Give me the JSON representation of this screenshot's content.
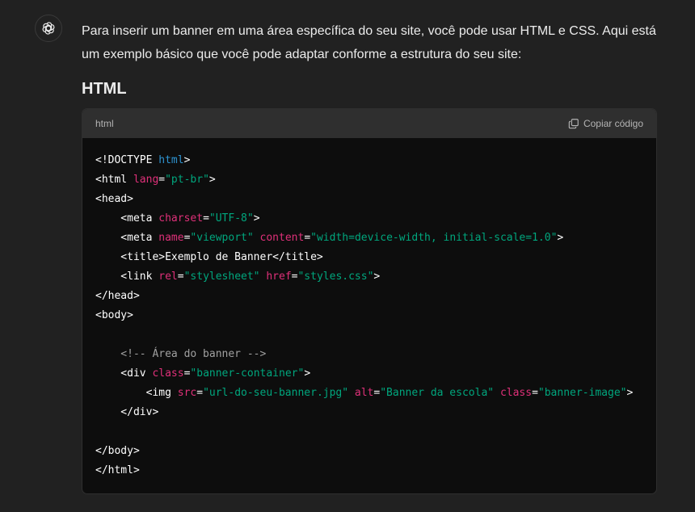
{
  "message": {
    "intro": "Para inserir um banner em uma área específica do seu site, você pode usar HTML e CSS. Aqui está um exemplo básico que você pode adaptar conforme a estrutura do seu site:",
    "heading": "HTML"
  },
  "code_block": {
    "language": "html",
    "copy_label": "Copiar código",
    "lines": [
      [
        {
          "t": "tag",
          "v": "<!DOCTYPE "
        },
        {
          "t": "kw",
          "v": "html"
        },
        {
          "t": "tag",
          "v": ">"
        }
      ],
      [
        {
          "t": "tag",
          "v": "<html "
        },
        {
          "t": "attr",
          "v": "lang"
        },
        {
          "t": "tag",
          "v": "="
        },
        {
          "t": "str",
          "v": "\"pt-br\""
        },
        {
          "t": "tag",
          "v": ">"
        }
      ],
      [
        {
          "t": "tag",
          "v": "<head>"
        }
      ],
      [
        {
          "t": "tag",
          "v": "    <meta "
        },
        {
          "t": "attr",
          "v": "charset"
        },
        {
          "t": "tag",
          "v": "="
        },
        {
          "t": "str",
          "v": "\"UTF-8\""
        },
        {
          "t": "tag",
          "v": ">"
        }
      ],
      [
        {
          "t": "tag",
          "v": "    <meta "
        },
        {
          "t": "attr",
          "v": "name"
        },
        {
          "t": "tag",
          "v": "="
        },
        {
          "t": "str",
          "v": "\"viewport\""
        },
        {
          "t": "tag",
          "v": " "
        },
        {
          "t": "attr",
          "v": "content"
        },
        {
          "t": "tag",
          "v": "="
        },
        {
          "t": "str",
          "v": "\"width=device-width, initial-scale=1.0\""
        },
        {
          "t": "tag",
          "v": ">"
        }
      ],
      [
        {
          "t": "tag",
          "v": "    <title>Exemplo de Banner</title>"
        }
      ],
      [
        {
          "t": "tag",
          "v": "    <link "
        },
        {
          "t": "attr",
          "v": "rel"
        },
        {
          "t": "tag",
          "v": "="
        },
        {
          "t": "str",
          "v": "\"stylesheet\""
        },
        {
          "t": "tag",
          "v": " "
        },
        {
          "t": "attr",
          "v": "href"
        },
        {
          "t": "tag",
          "v": "="
        },
        {
          "t": "str",
          "v": "\"styles.css\""
        },
        {
          "t": "tag",
          "v": ">"
        }
      ],
      [
        {
          "t": "tag",
          "v": "</head>"
        }
      ],
      [
        {
          "t": "tag",
          "v": "<body>"
        }
      ],
      [],
      [
        {
          "t": "cmt",
          "v": "    <!-- Área do banner -->"
        }
      ],
      [
        {
          "t": "tag",
          "v": "    <div "
        },
        {
          "t": "attr",
          "v": "class"
        },
        {
          "t": "tag",
          "v": "="
        },
        {
          "t": "str",
          "v": "\"banner-container\""
        },
        {
          "t": "tag",
          "v": ">"
        }
      ],
      [
        {
          "t": "tag",
          "v": "        <img "
        },
        {
          "t": "attr",
          "v": "src"
        },
        {
          "t": "tag",
          "v": "="
        },
        {
          "t": "str",
          "v": "\"url-do-seu-banner.jpg\""
        },
        {
          "t": "tag",
          "v": " "
        },
        {
          "t": "attr",
          "v": "alt"
        },
        {
          "t": "tag",
          "v": "="
        },
        {
          "t": "str",
          "v": "\"Banner da escola\""
        },
        {
          "t": "tag",
          "v": " "
        },
        {
          "t": "attr",
          "v": "class"
        },
        {
          "t": "tag",
          "v": "="
        },
        {
          "t": "str",
          "v": "\"banner-image\""
        },
        {
          "t": "tag",
          "v": ">"
        }
      ],
      [
        {
          "t": "tag",
          "v": "    </div>"
        }
      ],
      [],
      [
        {
          "t": "tag",
          "v": "</body>"
        }
      ],
      [
        {
          "t": "tag",
          "v": "</html>"
        }
      ]
    ]
  },
  "icons": {
    "avatar": "openai-logo-icon",
    "copy": "copy-icon"
  },
  "colors": {
    "background": "#212121",
    "code_background": "#0d0d0d",
    "code_header": "#2f2f2f",
    "keyword": "#2e95d3",
    "attribute": "#df3079",
    "string": "#00a67d",
    "comment": "#a0a0a0"
  }
}
